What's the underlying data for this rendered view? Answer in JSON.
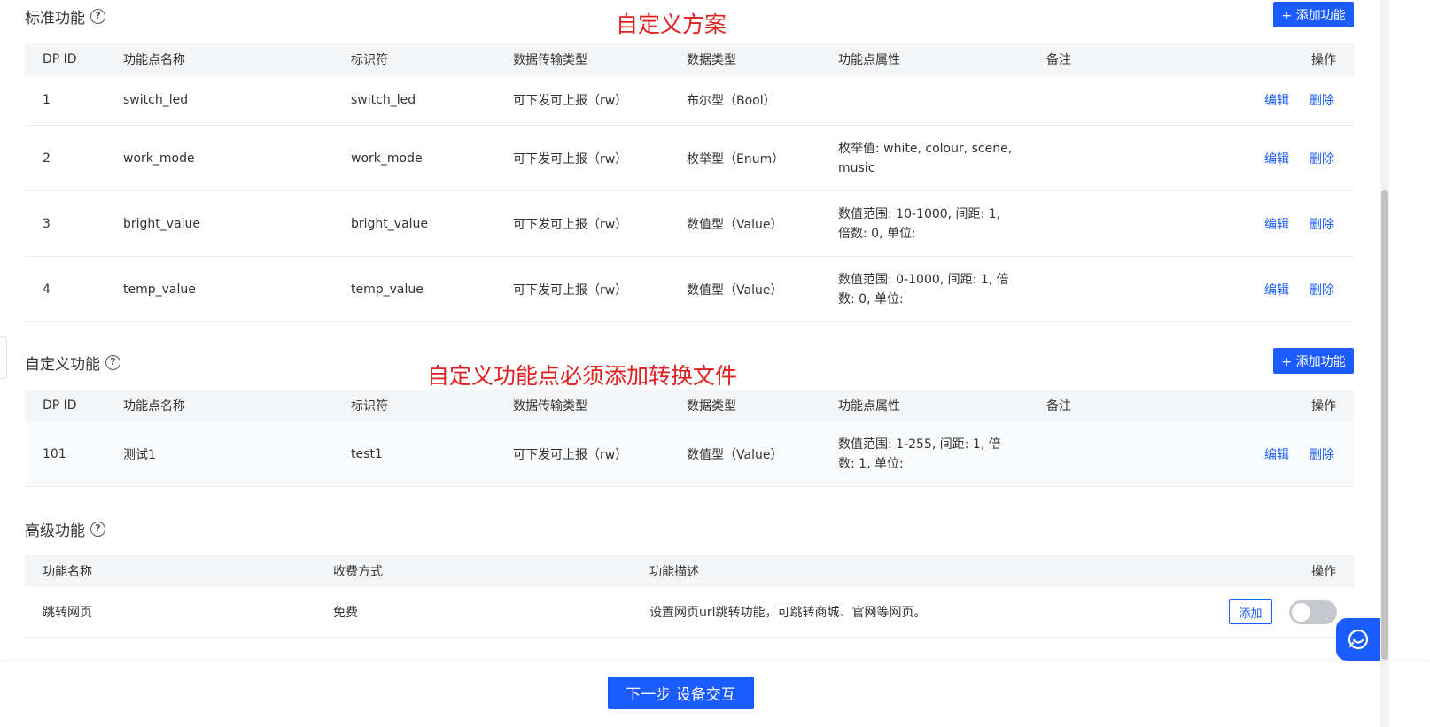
{
  "standard": {
    "title": "标准功能",
    "annotation": "自定义方案",
    "add_label": "+ 添加功能",
    "columns": [
      "DP ID",
      "功能点名称",
      "标识符",
      "数据传输类型",
      "数据类型",
      "功能点属性",
      "备注",
      "操作"
    ],
    "rows": [
      {
        "id": "1",
        "name": "switch_led",
        "identifier": "switch_led",
        "transfer": "可下发可上报（rw）",
        "dtype": "布尔型（Bool）",
        "attr": "",
        "note": "",
        "edit": "编辑",
        "delete": "删除"
      },
      {
        "id": "2",
        "name": "work_mode",
        "identifier": "work_mode",
        "transfer": "可下发可上报（rw）",
        "dtype": "枚举型（Enum）",
        "attr": "枚举值: white, colour, scene, music",
        "note": "",
        "edit": "编辑",
        "delete": "删除"
      },
      {
        "id": "3",
        "name": "bright_value",
        "identifier": "bright_value",
        "transfer": "可下发可上报（rw）",
        "dtype": "数值型（Value）",
        "attr": "数值范围: 10-1000, 间距: 1, 倍数: 0, 单位:",
        "note": "",
        "edit": "编辑",
        "delete": "删除"
      },
      {
        "id": "4",
        "name": "temp_value",
        "identifier": "temp_value",
        "transfer": "可下发可上报（rw）",
        "dtype": "数值型（Value）",
        "attr": "数值范围: 0-1000, 间距: 1, 倍数: 0, 单位:",
        "note": "",
        "edit": "编辑",
        "delete": "删除"
      }
    ]
  },
  "custom": {
    "title": "自定义功能",
    "annotation": "自定义功能点必须添加转换文件",
    "add_label": "+ 添加功能",
    "columns": [
      "DP ID",
      "功能点名称",
      "标识符",
      "数据传输类型",
      "数据类型",
      "功能点属性",
      "备注",
      "操作"
    ],
    "rows": [
      {
        "id": "101",
        "name": "测试1",
        "identifier": "test1",
        "transfer": "可下发可上报（rw）",
        "dtype": "数值型（Value）",
        "attr": "数值范围: 1-255, 间距: 1, 倍数: 1, 单位:",
        "note": "",
        "edit": "编辑",
        "delete": "删除"
      }
    ]
  },
  "advanced": {
    "title": "高级功能",
    "columns": [
      "功能名称",
      "收费方式",
      "功能描述",
      "操作"
    ],
    "rows": [
      {
        "name": "跳转网页",
        "fee": "免费",
        "desc": "设置网页url跳转功能，可跳转商城、官网等网页。",
        "add": "添加",
        "enabled": false
      }
    ]
  },
  "footer": {
    "next_label": "下一步 设备交互"
  },
  "colors": {
    "primary": "#1a5cff",
    "annotation": "#e02020"
  }
}
